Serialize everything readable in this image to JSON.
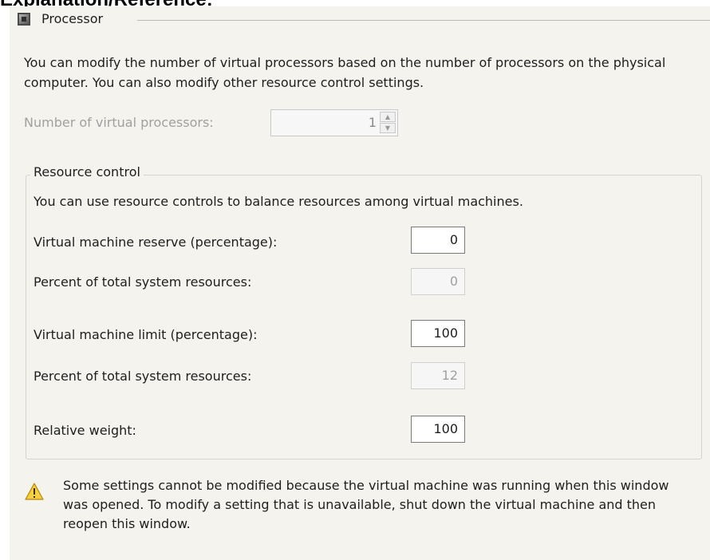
{
  "page_heading": "Explanation/Reference:",
  "section": {
    "title": "Processor"
  },
  "intro_text": "You can modify the number of virtual processors based on the number of processors on the physical computer. You can also modify other resource control settings.",
  "virtual_processors": {
    "label": "Number of virtual processors:",
    "value": "1"
  },
  "resource_control": {
    "legend": "Resource control",
    "intro": "You can use resource controls to balance resources among virtual machines.",
    "reserve_label": "Virtual machine reserve (percentage):",
    "reserve_value": "0",
    "reserve_percent_label": "Percent of total system resources:",
    "reserve_percent_value": "0",
    "limit_label": "Virtual machine limit (percentage):",
    "limit_value": "100",
    "limit_percent_label": "Percent of total system resources:",
    "limit_percent_value": "12",
    "weight_label": "Relative weight:",
    "weight_value": "100"
  },
  "warning": {
    "icon": "warning-icon",
    "text": "Some settings cannot be modified because the virtual machine was running when this window was opened. To modify a setting that is unavailable, shut down the virtual machine and then reopen this window."
  }
}
